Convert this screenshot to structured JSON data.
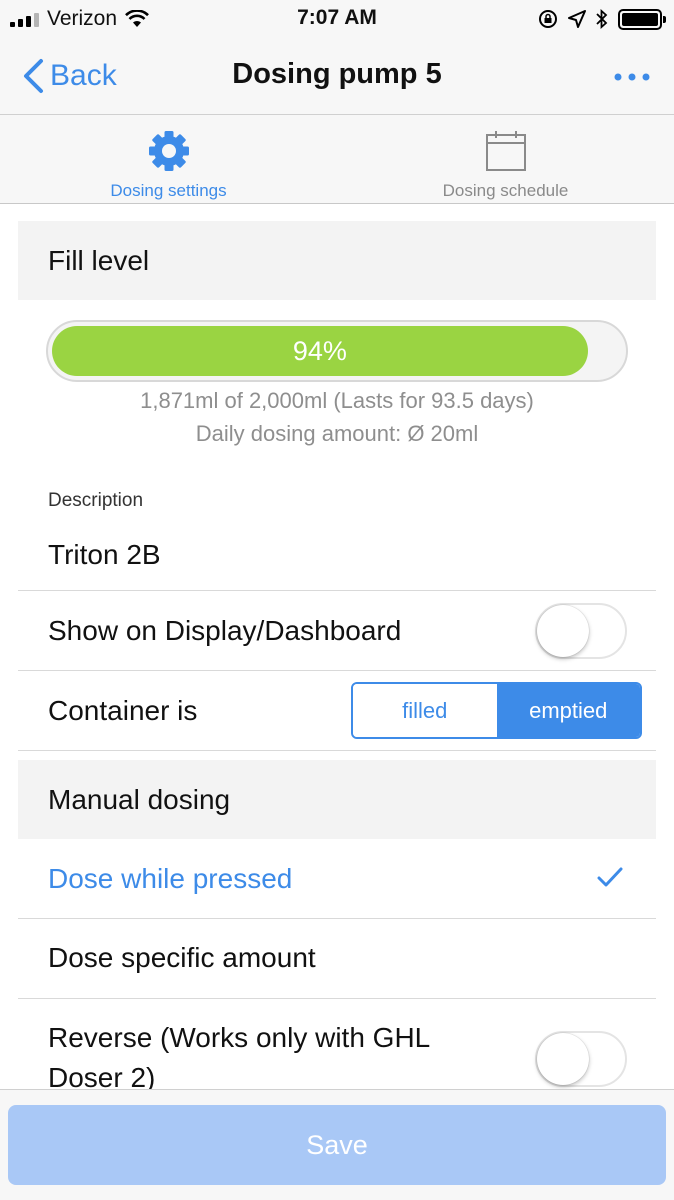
{
  "status_bar": {
    "carrier": "Verizon",
    "time": "7:07 AM"
  },
  "nav": {
    "back_label": "Back",
    "title": "Dosing pump 5"
  },
  "tabs": [
    {
      "label": "Dosing settings",
      "icon": "gear-icon",
      "active": true
    },
    {
      "label": "Dosing schedule",
      "icon": "calendar-icon",
      "active": false
    }
  ],
  "fill_level": {
    "header": "Fill level",
    "percent": 94,
    "percent_label": "94%",
    "amount_text": "1,871ml of 2,000ml (Lasts for 93.5 days)",
    "daily_text": "Daily dosing amount: Ø 20ml"
  },
  "description": {
    "label": "Description",
    "value": "Triton 2B"
  },
  "show_on_display": {
    "label": "Show on Display/Dashboard",
    "enabled": false
  },
  "container": {
    "label": "Container is",
    "options": [
      "filled",
      "emptied"
    ],
    "selected": "emptied"
  },
  "manual_dosing": {
    "header": "Manual dosing",
    "options": [
      {
        "label": "Dose while pressed",
        "selected": true
      },
      {
        "label": "Dose specific amount",
        "selected": false
      }
    ]
  },
  "reverse": {
    "label_line1": "Reverse (Works only with GHL",
    "label_line2": "Doser 2)",
    "enabled": false
  },
  "save_label": "Save",
  "colors": {
    "accent": "#3d8be8",
    "fill_green": "#9ad442",
    "save_disabled": "#a9c8f6"
  }
}
